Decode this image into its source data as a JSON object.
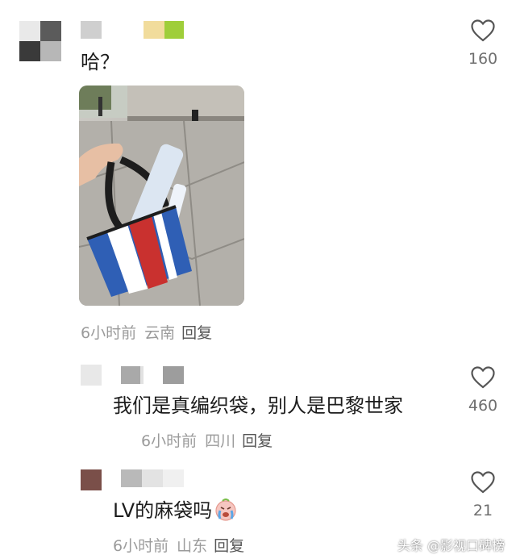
{
  "comments": [
    {
      "text": "哈？",
      "likes": "160",
      "time": "6小时前",
      "location": "云南",
      "reply_label": "回复"
    },
    {
      "text": "我们是真编织袋，别人是巴黎世家",
      "likes": "460",
      "time": "6小时前",
      "location": "四川",
      "reply_label": "回复"
    },
    {
      "text": "LV的麻袋吗",
      "likes": "21",
      "time": "6小时前",
      "location": "山东",
      "reply_label": "回复"
    }
  ],
  "icons": {
    "like": "heart-outline-icon",
    "emoji": "crying-face-emoji"
  },
  "watermark": "头条 @影视口碑榜",
  "colors": {
    "text": "#1c1c1c",
    "meta": "#9b9b9b",
    "bag_red": "#c9312f",
    "bag_blue": "#2f5fb5"
  }
}
